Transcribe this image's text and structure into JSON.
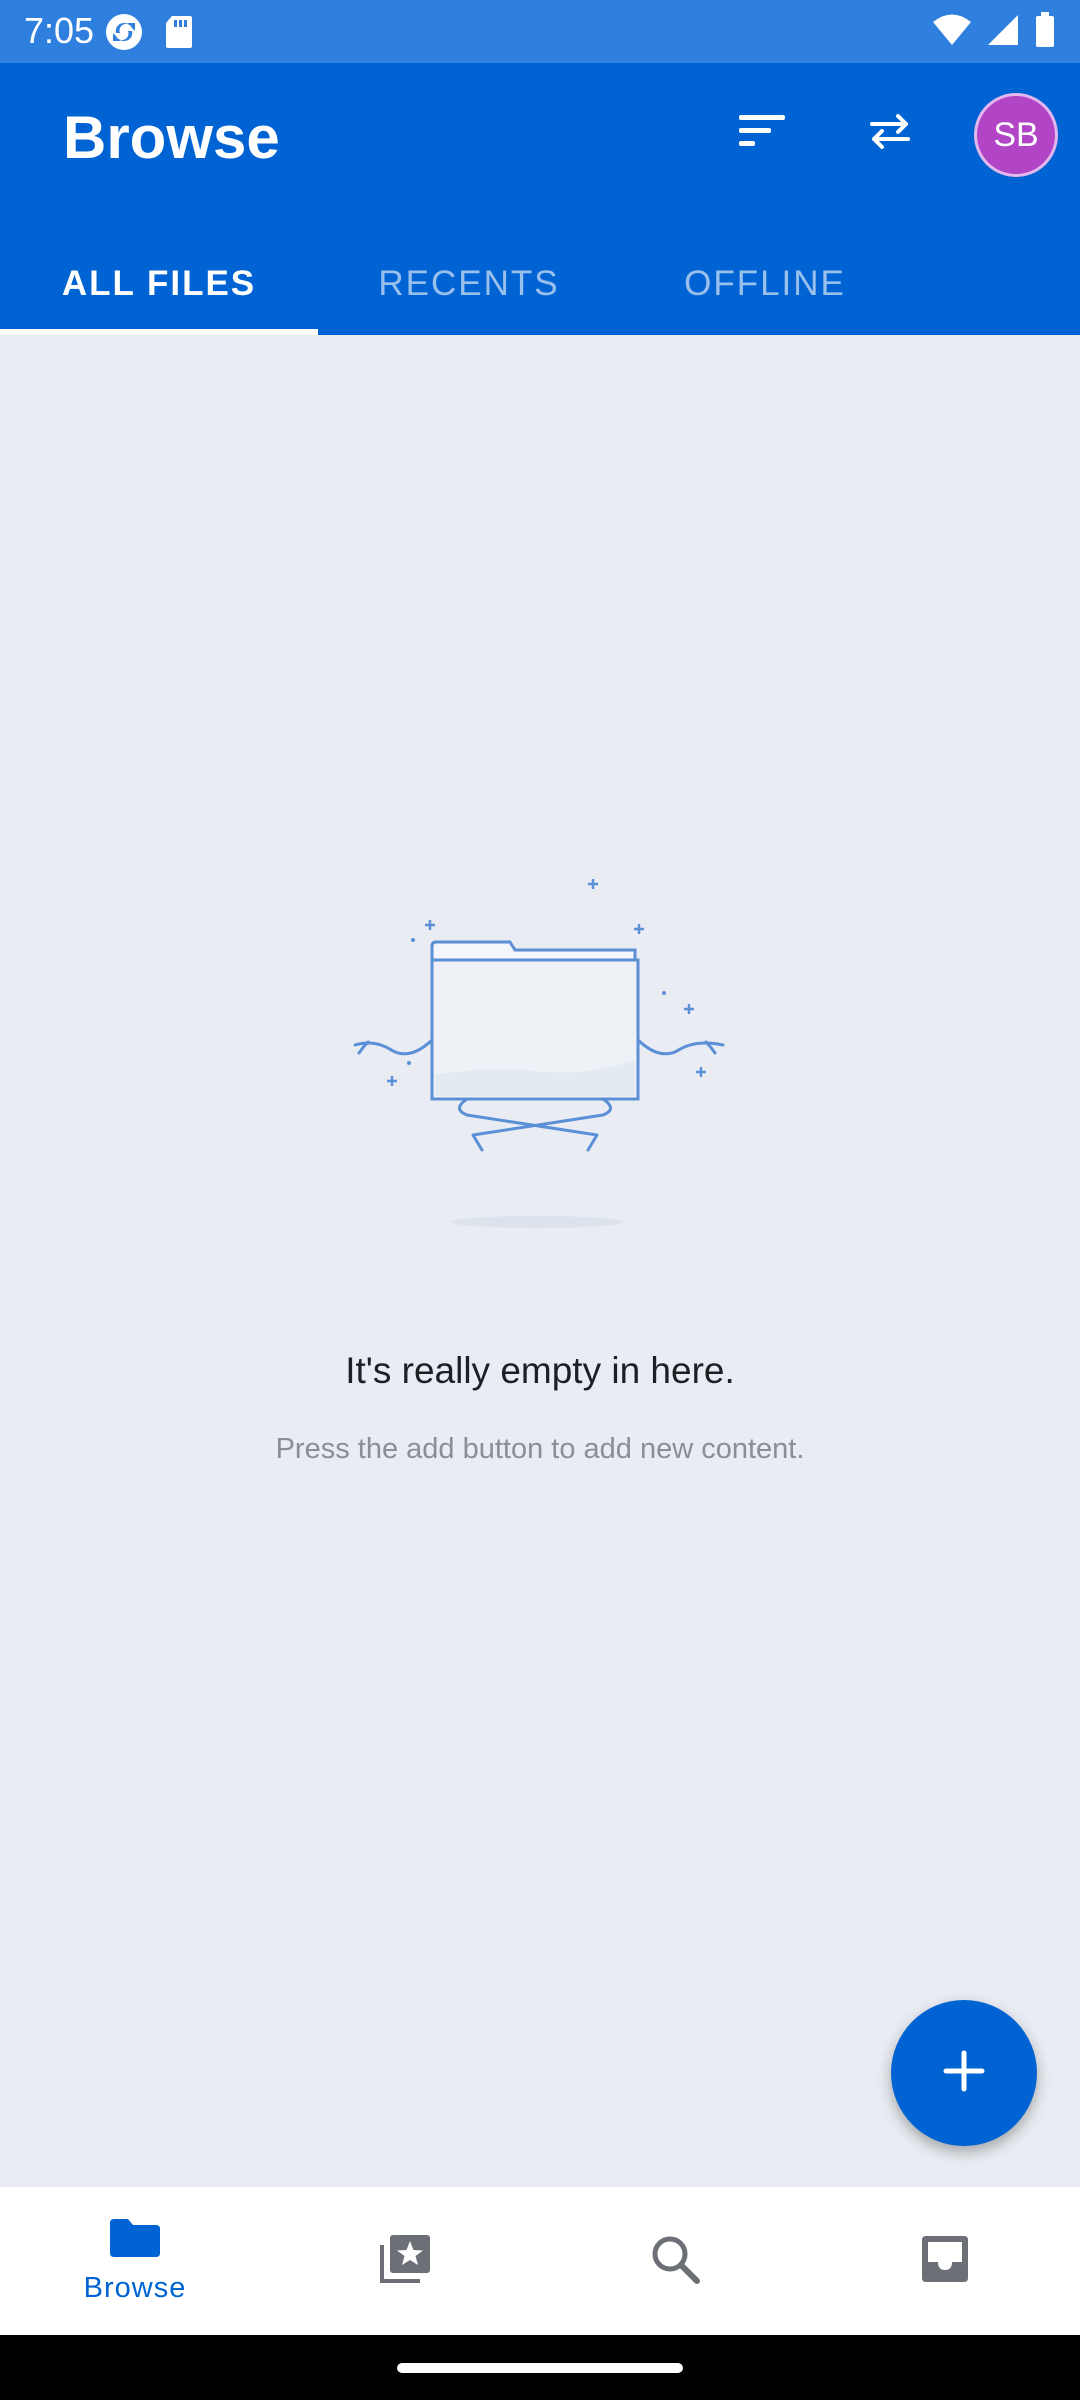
{
  "status_bar": {
    "time": "7:05"
  },
  "app_bar": {
    "title": "Browse",
    "avatar_initials": "SB"
  },
  "tabs": [
    {
      "label": "ALL FILES",
      "active": true
    },
    {
      "label": "RECENTS",
      "active": false
    },
    {
      "label": "OFFLINE",
      "active": false
    }
  ],
  "empty_state": {
    "title": "It's really empty in here.",
    "subtitle": "Press the add button to add new content."
  },
  "bottom_nav": [
    {
      "label": "Browse",
      "icon": "folder-icon",
      "active": true
    },
    {
      "label": "",
      "icon": "starred-photos-icon",
      "active": false
    },
    {
      "label": "",
      "icon": "search-icon",
      "active": false
    },
    {
      "label": "",
      "icon": "inbox-icon",
      "active": false
    }
  ],
  "colors": {
    "primary": "#0063d3",
    "status_bar": "#2f7fde",
    "avatar": "#b245c5",
    "background": "#e9ecf2"
  }
}
